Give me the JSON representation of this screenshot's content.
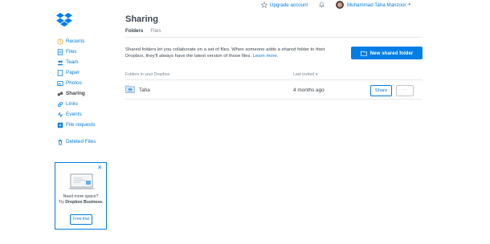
{
  "header": {
    "upgrade_label": "Upgrade account",
    "user_name": "Muhammad Taha Manzoor"
  },
  "sidebar": {
    "items": [
      {
        "label": "Recents",
        "icon": "clock-icon"
      },
      {
        "label": "Files",
        "icon": "files-icon"
      },
      {
        "label": "Team",
        "icon": "team-icon"
      },
      {
        "label": "Paper",
        "icon": "paper-icon"
      },
      {
        "label": "Photos",
        "icon": "photos-icon"
      },
      {
        "label": "Sharing",
        "icon": "link-icon"
      },
      {
        "label": "Links",
        "icon": "links-icon"
      },
      {
        "label": "Events",
        "icon": "events-icon"
      },
      {
        "label": "File requests",
        "icon": "file-request-icon"
      },
      {
        "label": "Deleted Files",
        "icon": "trash-icon"
      }
    ]
  },
  "promo": {
    "close": "✕",
    "line1": "Need more space?",
    "line2": "Try",
    "brand": "Dropbox Business.",
    "button": "Free trial"
  },
  "main": {
    "title": "Sharing",
    "tabs": [
      {
        "label": "Folders",
        "active": true
      },
      {
        "label": "Files",
        "active": false
      }
    ],
    "description": "Shared folders let you collaborate on a set of files. When someone adds a shared folder to their Dropbox, they'll always have the latest version of those files.",
    "learn_more": "Learn more.",
    "new_folder_label": "New shared folder",
    "table": {
      "col_name": "Folders in your Dropbox",
      "col_invited": "Last invited",
      "sort_arrow": "▾",
      "rows": [
        {
          "name": "Taha",
          "invited": "4 months ago",
          "share_label": "Share",
          "more_label": "···"
        }
      ]
    }
  },
  "colors": {
    "accent": "#007ee5",
    "text": "#3d464d",
    "muted": "#7b8994"
  }
}
